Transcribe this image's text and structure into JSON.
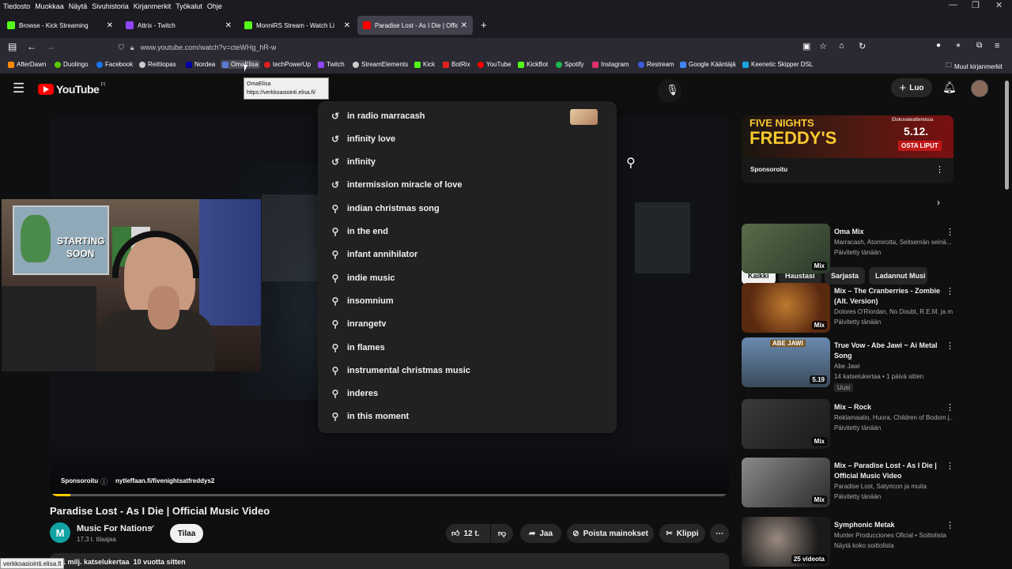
{
  "menubar": {
    "items": [
      "Tiedosto",
      "Muokkaa",
      "Näytä",
      "Sivuhistoria",
      "Kirjanmerkit",
      "Työkalut",
      "Ohje"
    ]
  },
  "tabs": [
    {
      "label": "Browse - Kick Streaming",
      "color": "#53fc18"
    },
    {
      "label": "Attrix - Twitch",
      "color": "#9146ff"
    },
    {
      "label": "MonniRS Stream - Watch Li",
      "color": "#53fc18"
    },
    {
      "label": "Paradise Lost - As I Die | Official",
      "color": "#ff0000"
    }
  ],
  "url": "www.youtube.com/watch?v=cteWHg_hR-w",
  "bookmarks": [
    {
      "label": "AfterDawn",
      "color": "#ff8a00"
    },
    {
      "label": "Duolingo",
      "color": "#58cc02"
    },
    {
      "label": "Facebook",
      "color": "#1877f2"
    },
    {
      "label": "Reittiopas",
      "color": "#cccccc"
    },
    {
      "label": "Nordea",
      "color": "#0000a0"
    },
    {
      "label": "OmaElisa",
      "color": "#5a7bd6"
    },
    {
      "label": "techPowerUp",
      "color": "#e02020"
    },
    {
      "label": "Twitch",
      "color": "#9146ff"
    },
    {
      "label": "StreamElements",
      "color": "#cccccc"
    },
    {
      "label": "Kick",
      "color": "#53fc18"
    },
    {
      "label": "BotRix",
      "color": "#e02020"
    },
    {
      "label": "YouTube",
      "color": "#ff0000"
    },
    {
      "label": "KickBot",
      "color": "#53fc18"
    },
    {
      "label": "Spotify",
      "color": "#1db954"
    },
    {
      "label": "Instagram",
      "color": "#e1306c"
    },
    {
      "label": "Restream",
      "color": "#3b5bdb"
    },
    {
      "label": "Google Kääntäjä",
      "color": "#4285f4"
    },
    {
      "label": "Keenetic Skipper DSL",
      "color": "#1aa5e0"
    }
  ],
  "bookmarks_other": "Muut kirjanmerkit",
  "tooltip": {
    "title": "OmaElisa",
    "url": "https://verkkoasiointi.elisa.fi/"
  },
  "youtube": {
    "logo": "YouTube",
    "region": "FI",
    "search_value": "in",
    "create_label": "Luo",
    "suggestions": [
      {
        "text": "in radio marracash",
        "type": "history"
      },
      {
        "text": "infinity love",
        "type": "history"
      },
      {
        "text": "infinity",
        "type": "history"
      },
      {
        "text": "intermission miracle of love",
        "type": "history"
      },
      {
        "text": "indian christmas song",
        "type": "search"
      },
      {
        "text": "in the end",
        "type": "search"
      },
      {
        "text": "infant annihilator",
        "type": "search"
      },
      {
        "text": "indie music",
        "type": "search"
      },
      {
        "text": "insomnium",
        "type": "search"
      },
      {
        "text": "inrangetv",
        "type": "search"
      },
      {
        "text": "in flames",
        "type": "search"
      },
      {
        "text": "instrumental christmas music",
        "type": "search"
      },
      {
        "text": "inderes",
        "type": "search"
      },
      {
        "text": "in this moment",
        "type": "search"
      }
    ],
    "webcam": {
      "sign_line1": "STARTING",
      "sign_line2": "SOON"
    },
    "ad": {
      "label": "Sponsoroitu",
      "link": "nytleffaan.fi/fivenightsatfreddys2"
    },
    "video_title": "Paradise Lost - As I Die | Official Music Video",
    "channel": {
      "name": "Music For Nations",
      "initial": "M",
      "subs": "17,3 t. tilaajaa",
      "subscribe": "Tilaa"
    },
    "actions": {
      "likes": "12 t.",
      "share": "Jaa",
      "remove_ads": "Poista mainokset",
      "clip": "Klippi"
    },
    "views": "1 milj. katselukertaa  10 vuotta sitten",
    "status_url": "verkkoasiointi.elisa.fi",
    "banner": {
      "title_line1": "FIVE NIGHTS",
      "title_line2": "FREDDY'S",
      "promo_line1": "Elokuvateattereissa",
      "promo_date": "5.12.",
      "promo_cta": "OSTA LIPUT",
      "sponsored": "Sponsoroitu"
    },
    "chips": [
      "Kaikki",
      "Haustasi",
      "Sarjasta",
      "Ladannut Musi"
    ],
    "recs": [
      {
        "title": "Oma Mix",
        "sub1": "Marracash, Atomirotta, Seitsemän seinä...",
        "sub2": "Päivitetty tänään",
        "badge": "Mix"
      },
      {
        "title": "Mix – The Cranberries - Zombie (Alt. Version)",
        "sub1": "Dolores O'Riordan, No Doubt, R.E.M. ja m...",
        "sub2": "Päivitetty tänään",
        "badge": "Mix"
      },
      {
        "title": "True Vow - Abe Jawi ~ Ai Metal Song",
        "sub1": "Abe Jawi",
        "sub2": "14 katselukertaa • 1 päivä sitten",
        "badge": "5.19",
        "tag": "Uusi",
        "thumb_text": "ABE JAWI"
      },
      {
        "title": "Mix – Rock",
        "sub1": "Reklamaatio, Huora, Children of Bodom j...",
        "sub2": "Päivitetty tänään",
        "badge": "Mix"
      },
      {
        "title": "Mix – Paradise Lost - As I Die | Official Music Video",
        "sub1": "Paradise Lost, Satyricon ja muita",
        "sub2": "Päivitetty tänään",
        "badge": "Mix"
      },
      {
        "title": "Symphonic Metak",
        "sub1": "Munter Producciones Oficial • Soittolista",
        "sub2": "Näytä koko soittolista",
        "badge": "25 videota"
      }
    ]
  }
}
